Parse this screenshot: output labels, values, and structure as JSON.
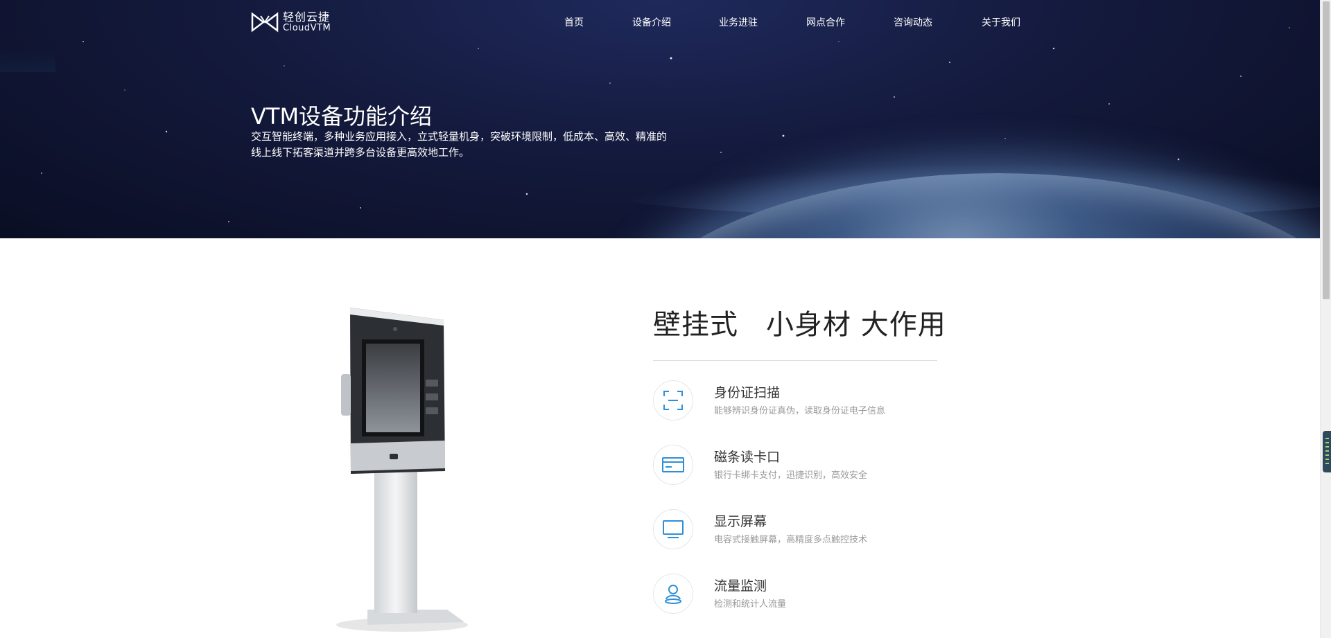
{
  "brand": {
    "name_cn": "轻创云捷",
    "name_en": "CloudVTM"
  },
  "nav": {
    "items": [
      {
        "label": "首页"
      },
      {
        "label": "设备介绍"
      },
      {
        "label": "业务进驻"
      },
      {
        "label": "网点合作"
      },
      {
        "label": "咨询动态"
      },
      {
        "label": "关于我们"
      }
    ]
  },
  "hero": {
    "title": "VTM设备功能介绍",
    "desc_line1": "交互智能终端，多种业务应用接入，立式轻量机身，突破环境限制，低成本、高效、精准的",
    "desc_line2": "线上线下拓客渠道并跨多台设备更高效地工作。"
  },
  "product": {
    "title_part1": "壁挂式",
    "title_part2": "小身材 大作用",
    "features": [
      {
        "icon": "scan-icon",
        "title": "身份证扫描",
        "desc": "能够辨识身份证真伪，读取身份证电子信息"
      },
      {
        "icon": "card-icon",
        "title": "磁条读卡口",
        "desc": "银行卡绑卡支付，迅捷识别，高效安全"
      },
      {
        "icon": "monitor-icon",
        "title": "显示屏幕",
        "desc": "电容式接触屏幕，高精度多点触控技术"
      },
      {
        "icon": "person-location-icon",
        "title": "流量监测",
        "desc": "检测和统计人流量"
      }
    ]
  },
  "colors": {
    "hero_bg": "#141a3d",
    "icon_blue": "#2e8fd9",
    "title_text": "#222222",
    "desc_text": "#999999"
  }
}
